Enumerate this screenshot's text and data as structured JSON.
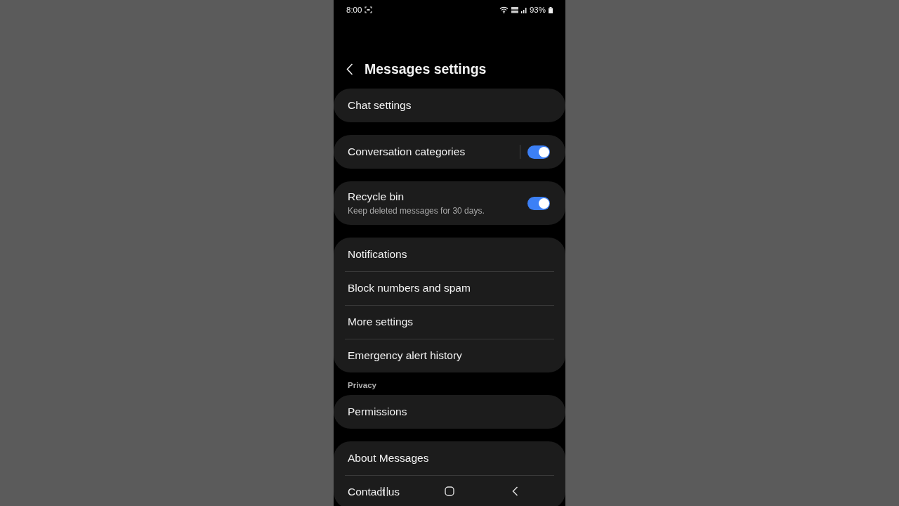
{
  "status_bar": {
    "time": "8:00",
    "battery": "93%"
  },
  "header": {
    "title": "Messages settings"
  },
  "groups": [
    {
      "items": [
        {
          "kind": "link",
          "label": "Chat settings"
        }
      ]
    },
    {
      "items": [
        {
          "kind": "toggle",
          "label": "Conversation categories",
          "on": true,
          "divider": true
        }
      ]
    },
    {
      "items": [
        {
          "kind": "toggle",
          "label": "Recycle bin",
          "subtitle": "Keep deleted messages for 30 days.",
          "on": true
        }
      ]
    },
    {
      "items": [
        {
          "kind": "link",
          "label": "Notifications"
        },
        {
          "kind": "link",
          "label": "Block numbers and spam"
        },
        {
          "kind": "link",
          "label": "More settings"
        },
        {
          "kind": "link",
          "label": "Emergency alert history"
        }
      ]
    },
    {
      "section": "Privacy",
      "items": [
        {
          "kind": "link",
          "label": "Permissions"
        }
      ]
    },
    {
      "items": [
        {
          "kind": "link",
          "label": "About Messages"
        },
        {
          "kind": "link",
          "label": "Contact us"
        }
      ]
    }
  ]
}
